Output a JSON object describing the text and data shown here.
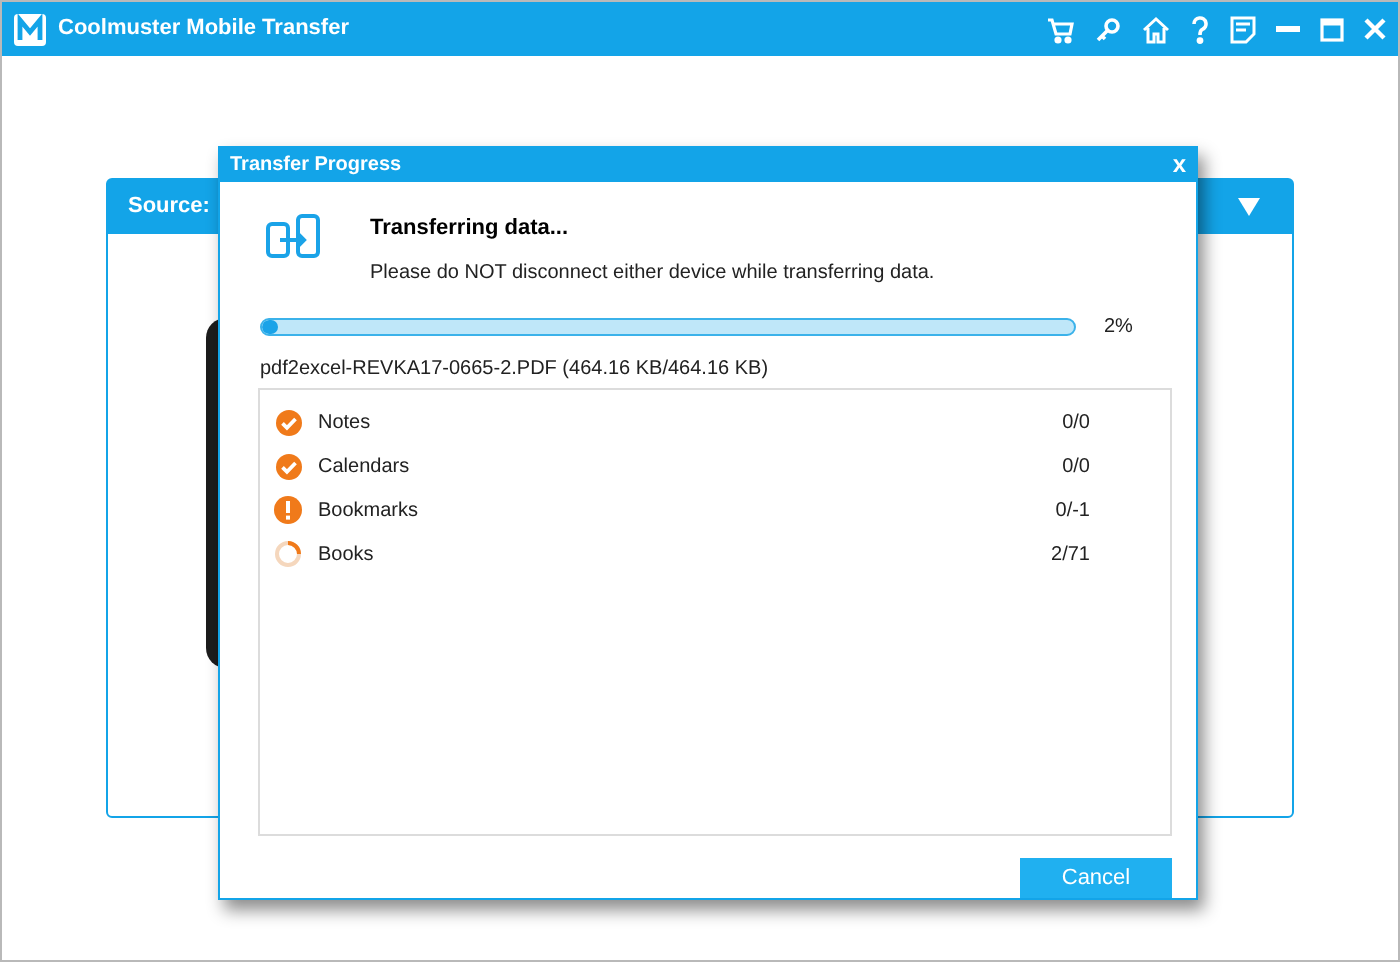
{
  "window": {
    "title": "Coolmuster Mobile Transfer"
  },
  "source_panel": {
    "title": "Source: "
  },
  "dialog": {
    "title": "Transfer Progress",
    "close": "x",
    "heading": "Transferring data...",
    "message": "Please do NOT disconnect either device while transferring data.",
    "progress": {
      "level": 0.02,
      "reading": "2%"
    },
    "current_file": "pdf2excel-REVKA17-0665-2.PDF (464.16 KB/464.16 KB)",
    "items": [
      {
        "name": "Notes",
        "count": "0/0",
        "kind": "done"
      },
      {
        "name": "Calendars",
        "count": "0/0",
        "kind": "done"
      },
      {
        "name": "Bookmarks",
        "count": "0/-1",
        "kind": "error"
      },
      {
        "name": "Books",
        "count": "2/71",
        "kind": "progress"
      }
    ],
    "cancel_button": "Cancel"
  }
}
